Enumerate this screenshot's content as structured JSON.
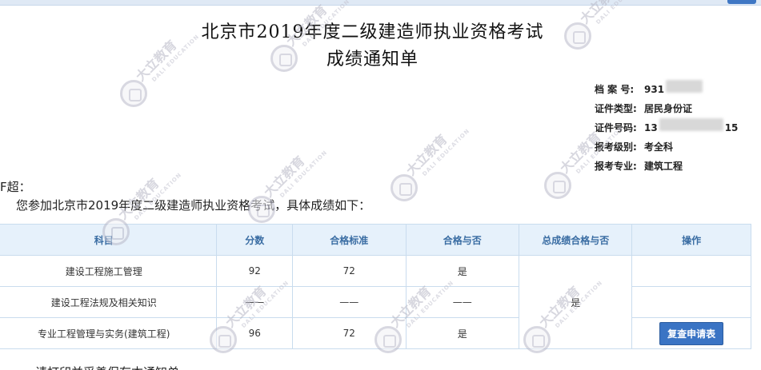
{
  "title": {
    "line1": "北京市2019年度二级建造师执业资格考试",
    "line2": "成绩通知单"
  },
  "info": {
    "archive_label": "档 案 号:",
    "archive_value": "931",
    "id_type_label": "证件类型:",
    "id_type_value": "居民身份证",
    "id_number_label": "证件号码:",
    "id_number_prefix": "13",
    "id_number_suffix": "15",
    "level_label": "报考级别:",
    "level_value": "考全科",
    "major_label": "报考专业:",
    "major_value": "建筑工程"
  },
  "greeting": "F超：",
  "intro": "您参加北京市2019年度二级建造师执业资格考试，具体成绩如下：",
  "table": {
    "headers": [
      "科目",
      "分数",
      "合格标准",
      "合格与否",
      "总成绩合格与否",
      "操作"
    ],
    "rows": [
      {
        "subject": "建设工程施工管理",
        "score": "92",
        "standard": "72",
        "pass": "是"
      },
      {
        "subject": "建设工程法规及相关知识",
        "score": "——",
        "standard": "——",
        "pass": "——"
      },
      {
        "subject": "专业工程管理与实务(建筑工程)",
        "score": "96",
        "standard": "72",
        "pass": "是"
      }
    ],
    "overall_pass": "是",
    "recheck_button": "复查申请表"
  },
  "footer": "请打印并妥善保存本通知单",
  "watermark": {
    "text": "大立教育",
    "sub": "DALI EDUCATION",
    "color": "#b8b8c6"
  }
}
